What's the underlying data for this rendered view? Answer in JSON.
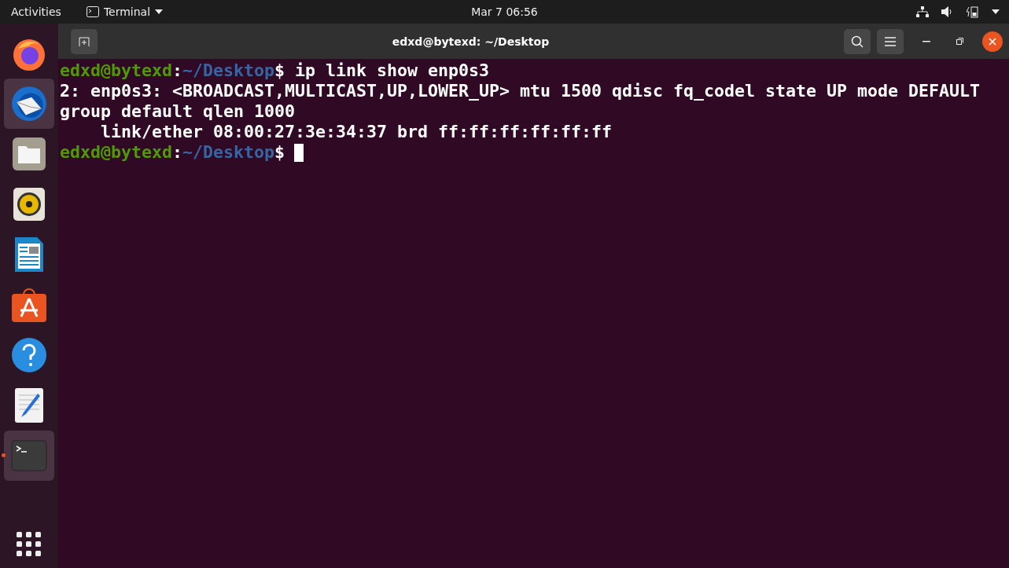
{
  "top_bar": {
    "activities": "Activities",
    "app_menu": "Terminal",
    "clock": "Mar 7  06:56"
  },
  "dock": {
    "items": [
      {
        "kind": "browser",
        "highlighted": false,
        "running": false
      },
      {
        "kind": "mail",
        "highlighted": true,
        "running": false
      },
      {
        "kind": "files",
        "highlighted": false,
        "running": false
      },
      {
        "kind": "music",
        "highlighted": false,
        "running": false
      },
      {
        "kind": "writer",
        "highlighted": false,
        "running": false
      },
      {
        "kind": "store",
        "highlighted": false,
        "running": false
      },
      {
        "kind": "help",
        "highlighted": false,
        "running": false
      },
      {
        "kind": "editor",
        "highlighted": false,
        "running": false
      },
      {
        "kind": "terminal",
        "highlighted": true,
        "running": true
      }
    ]
  },
  "window": {
    "title": "edxd@bytexd: ~/Desktop"
  },
  "terminal": {
    "lines": [
      {
        "kind": "prompt",
        "user": "edxd@bytexd",
        "separator": ":",
        "path": "~/Desktop",
        "symbol": "$",
        "command": "ip link show enp0s3",
        "cursor": false
      },
      {
        "kind": "output",
        "text": "2: enp0s3: <BROADCAST,MULTICAST,UP,LOWER_UP> mtu 1500 qdisc fq_codel state UP mode DEFAULT"
      },
      {
        "kind": "output",
        "text": "group default qlen 1000"
      },
      {
        "kind": "output",
        "text": "    link/ether 08:00:27:3e:34:37 brd ff:ff:ff:ff:ff:ff"
      },
      {
        "kind": "prompt",
        "user": "edxd@bytexd",
        "separator": ":",
        "path": "~/Desktop",
        "symbol": "$",
        "cursor": true
      }
    ]
  }
}
